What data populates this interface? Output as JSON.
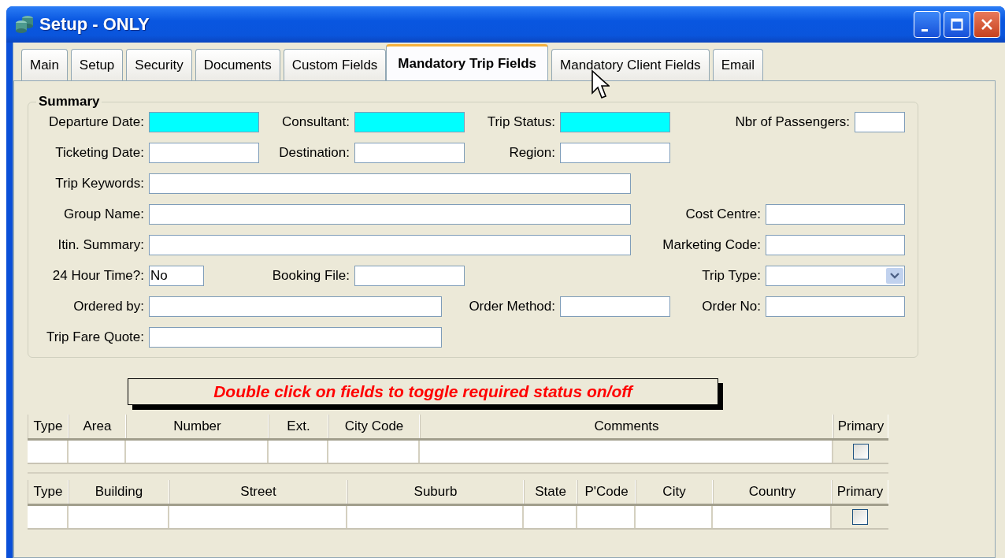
{
  "window": {
    "title": "Setup - ONLY"
  },
  "tabs": [
    {
      "label": "Main",
      "selected": false
    },
    {
      "label": "Setup",
      "selected": false
    },
    {
      "label": "Security",
      "selected": false
    },
    {
      "label": "Documents",
      "selected": false
    },
    {
      "label": "Custom Fields",
      "selected": false
    },
    {
      "label": "Mandatory Trip Fields",
      "selected": true
    },
    {
      "label": "Mandatory Client Fields",
      "selected": false
    },
    {
      "label": "Email",
      "selected": false
    }
  ],
  "summary": {
    "title": "Summary",
    "rows": [
      [
        {
          "label": "Departure Date:",
          "required": true,
          "kind": "text"
        },
        {
          "label": "Consultant:",
          "required": true,
          "kind": "text"
        },
        {
          "label": "Trip Status:",
          "required": true,
          "kind": "text"
        },
        {
          "label": "Nbr of Passengers:",
          "required": false,
          "kind": "text"
        }
      ],
      [
        {
          "label": "Ticketing Date:",
          "required": false,
          "kind": "text"
        },
        {
          "label": "Destination:",
          "required": false,
          "kind": "text"
        },
        {
          "label": "Region:",
          "required": false,
          "kind": "text"
        },
        ""
      ],
      [
        {
          "label": "Trip Keywords:",
          "required": false,
          "kind": "text"
        },
        "",
        "",
        ""
      ],
      [
        {
          "label": "Group Name:",
          "required": false,
          "kind": "text"
        },
        "",
        "",
        {
          "label": "Cost Centre:",
          "required": false,
          "kind": "text"
        }
      ],
      [
        {
          "label": "Itin. Summary:",
          "required": false,
          "kind": "text"
        },
        "",
        "",
        {
          "label": "Marketing Code:",
          "required": false,
          "kind": "text"
        }
      ],
      [
        {
          "label": "24 Hour Time?:",
          "required": false,
          "kind": "text",
          "value": "No"
        },
        {
          "label": "Booking File:",
          "required": false,
          "kind": "text"
        },
        "",
        {
          "label": "Trip Type:",
          "required": false,
          "kind": "dropdown"
        }
      ],
      [
        {
          "label": "Ordered by:",
          "required": false,
          "kind": "text"
        },
        "",
        {
          "label": "Order Method:",
          "required": false,
          "kind": "text"
        },
        {
          "label": "Order No:",
          "required": false,
          "kind": "text"
        }
      ],
      [
        {
          "label": "Trip Fare Quote:",
          "required": false,
          "kind": "text"
        }
      ]
    ]
  },
  "notice": "Double click on fields to toggle required status on/off",
  "phone_table": {
    "columns": [
      "Type",
      "Area",
      "Number",
      "Ext.",
      "City Code",
      "Comments",
      "Primary"
    ],
    "rows": [
      {
        "primary_checked": false
      }
    ]
  },
  "address_table": {
    "columns": [
      "Type",
      "Building",
      "Street",
      "Suburb",
      "State",
      "P'Code",
      "City",
      "Country",
      "Primary"
    ],
    "rows": [
      {
        "primary_checked": false
      }
    ]
  }
}
